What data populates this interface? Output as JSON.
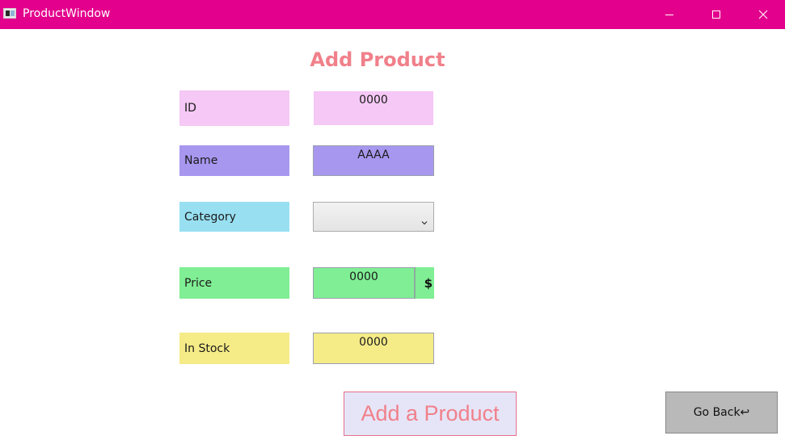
{
  "window": {
    "title": "ProductWindow",
    "title_bar_color": "#e3008c"
  },
  "form": {
    "heading": "Add Product",
    "fields": {
      "id": {
        "label": "ID",
        "value": "0000",
        "color": "#f5c8f5"
      },
      "name": {
        "label": "Name",
        "value": "AAAA",
        "color": "#a897ef"
      },
      "category": {
        "label": "Category",
        "value": "",
        "color": "#98e0f1",
        "control": "dropdown"
      },
      "price": {
        "label": "Price",
        "value": "0000",
        "suffix": "$",
        "color": "#80ee94"
      },
      "in_stock": {
        "label": "In Stock",
        "value": "0000",
        "color": "#f5eb87"
      }
    }
  },
  "actions": {
    "add_label": "Add a Product",
    "back_label": "Go Back↩"
  },
  "icons": {
    "app": "app-window-icon",
    "minimize": "minimize-icon",
    "maximize": "maximize-icon",
    "close": "close-icon",
    "dropdown": "chevron-down-icon"
  },
  "colors": {
    "accent_text": "#f0808a",
    "add_button_bg": "#e6e5f8",
    "back_button_bg": "#b9b9b9"
  }
}
